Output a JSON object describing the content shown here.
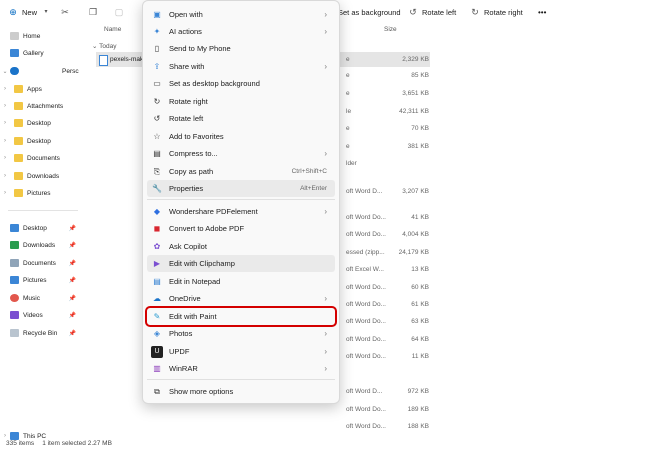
{
  "toolbar": {
    "new_label": "New",
    "set_background_label": "Set as background",
    "rotate_left_label": "Rotate left",
    "rotate_right_label": "Rotate right",
    "more_label": "•••"
  },
  "nav": {
    "home": "Home",
    "gallery": "Gallery",
    "onedrive_partial": "Persc",
    "folders": [
      "Apps",
      "Attachments",
      "Desktop",
      "Desktop",
      "Documents",
      "Downloads",
      "Pictures"
    ],
    "quick": [
      "Desktop",
      "Downloads",
      "Documents",
      "Pictures",
      "Music",
      "Videos",
      "Recycle Bin"
    ],
    "this_pc_partial": "This PC"
  },
  "columns": {
    "name": "Name",
    "size": "Size"
  },
  "group_today": "Today",
  "selected_file": "pexels-mak",
  "rows": [
    {
      "type": "e",
      "size": "2,329 KB"
    },
    {
      "type": "e",
      "size": "85 KB"
    },
    {
      "type": "e",
      "size": "3,651 KB"
    },
    {
      "type": "le",
      "size": "42,311 KB"
    },
    {
      "type": "e",
      "size": "70 KB"
    },
    {
      "type": "e",
      "size": "381 KB"
    },
    {
      "type": "lder",
      "size": ""
    },
    {
      "type": "",
      "size": ""
    },
    {
      "type": "oft Word D...",
      "size": "3,207 KB"
    },
    {
      "type": "oft Word Do...",
      "size": "41 KB"
    },
    {
      "type": "oft Word Do...",
      "size": "4,004 KB"
    },
    {
      "type": "essed (zipp...",
      "size": "24,179 KB"
    },
    {
      "type": "oft Excel W...",
      "size": "13 KB"
    },
    {
      "type": "oft Word Do...",
      "size": "60 KB"
    },
    {
      "type": "oft Word Do...",
      "size": "61 KB"
    },
    {
      "type": "oft Word Do...",
      "size": "63 KB"
    },
    {
      "type": "oft Word Do...",
      "size": "64 KB"
    },
    {
      "type": "oft Word Do...",
      "size": "11 KB"
    },
    {
      "type": "",
      "size": ""
    },
    {
      "type": "oft Word D...",
      "size": "972 KB"
    },
    {
      "type": "oft Word Do...",
      "size": "189 KB"
    },
    {
      "type": "oft Word Do...",
      "size": "188 KB"
    }
  ],
  "status": {
    "count": "335 items",
    "selected": "1 item selected  2.27 MB"
  },
  "menu": {
    "items": [
      {
        "label": "Open with",
        "icon": "open-with-icon",
        "submenu": true
      },
      {
        "label": "AI actions",
        "icon": "ai-actions-icon",
        "submenu": true
      },
      {
        "label": "Send to My Phone",
        "icon": "phone-icon"
      },
      {
        "label": "Share with",
        "icon": "share-icon",
        "submenu": true
      },
      {
        "label": "Set as desktop background",
        "icon": "desktop-background-icon"
      },
      {
        "label": "Rotate right",
        "icon": "rotate-right-icon"
      },
      {
        "label": "Rotate left",
        "icon": "rotate-left-icon"
      },
      {
        "label": "Add to Favorites",
        "icon": "star-icon"
      },
      {
        "label": "Compress to...",
        "icon": "compress-icon",
        "submenu": true
      },
      {
        "label": "Copy as path",
        "icon": "copy-path-icon",
        "shortcut": "Ctrl+Shift+C"
      },
      {
        "label": "Properties",
        "icon": "properties-icon",
        "shortcut": "Alt+Enter"
      },
      {
        "label": "Wondershare PDFelement",
        "icon": "pdfelement-icon",
        "submenu": true
      },
      {
        "label": "Convert to Adobe PDF",
        "icon": "adobe-pdf-icon"
      },
      {
        "label": "Ask Copilot",
        "icon": "copilot-icon"
      },
      {
        "label": "Edit with Clipchamp",
        "icon": "clipchamp-icon"
      },
      {
        "label": "Edit in Notepad",
        "icon": "notepad-icon"
      },
      {
        "label": "OneDrive",
        "icon": "onedrive-icon",
        "submenu": true
      },
      {
        "label": "Edit with Paint",
        "icon": "paint-icon"
      },
      {
        "label": "Photos",
        "icon": "photos-icon",
        "submenu": true
      },
      {
        "label": "UPDF",
        "icon": "updf-icon",
        "submenu": true
      },
      {
        "label": "WinRAR",
        "icon": "winrar-icon",
        "submenu": true
      },
      {
        "label": "Show more options",
        "icon": "more-options-icon"
      }
    ]
  },
  "colors": {
    "highlight": "#d40000",
    "accent": "#0067c0"
  }
}
